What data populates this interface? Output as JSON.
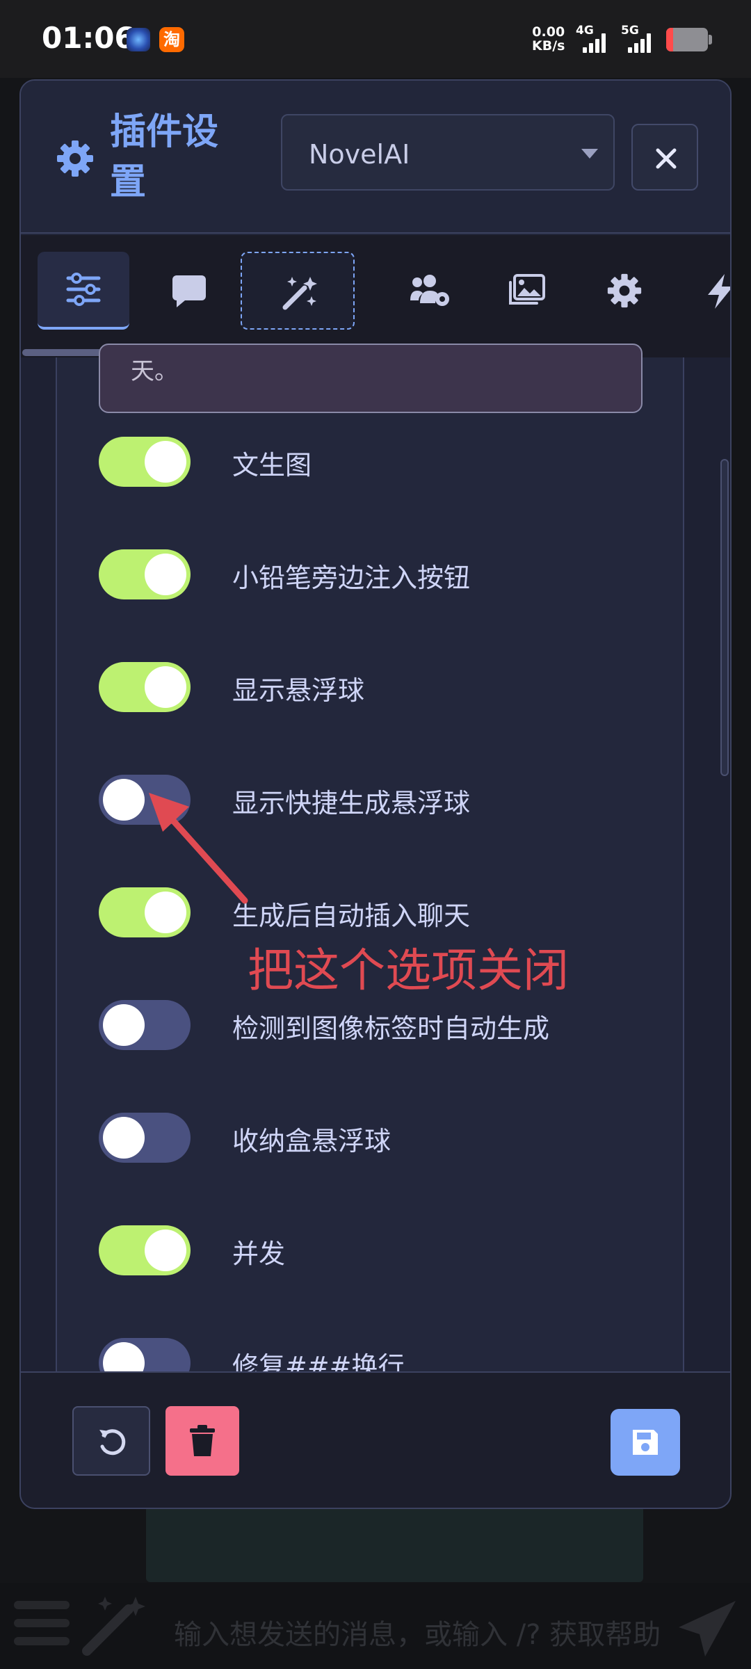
{
  "status_bar": {
    "time": "01:06",
    "app_badge": "淘",
    "speed_value": "0.00",
    "speed_unit": "KB/s",
    "net1": "4G",
    "net2": "5G"
  },
  "dialog": {
    "title": "插件设置",
    "provider_select": {
      "value": "NovelAI"
    },
    "tabs": [
      {
        "icon": "sliders-icon",
        "active": true
      },
      {
        "icon": "chat-bubble-icon",
        "active": false
      },
      {
        "icon": "magic-wand-icon",
        "focused": true
      },
      {
        "icon": "users-cog-icon",
        "active": false
      },
      {
        "icon": "images-icon",
        "active": false
      },
      {
        "icon": "gear-icon",
        "active": false
      },
      {
        "icon": "bolt-icon",
        "active": false
      }
    ],
    "textarea_fragment": "天。",
    "toggles": [
      {
        "label": "文生图",
        "on": true
      },
      {
        "label": "小铅笔旁边注入按钮",
        "on": true
      },
      {
        "label": "显示悬浮球",
        "on": true
      },
      {
        "label": "显示快捷生成悬浮球",
        "on": false
      },
      {
        "label": "生成后自动插入聊天",
        "on": true
      },
      {
        "label": "检测到图像标签时自动生成",
        "on": false
      },
      {
        "label": "收纳盒悬浮球",
        "on": false
      },
      {
        "label": "并发",
        "on": true
      },
      {
        "label": "修复###换行",
        "on": false
      }
    ]
  },
  "annotation": {
    "text": "把这个选项关闭",
    "color": "#e04a52"
  },
  "background_app": {
    "input_placeholder": "输入想发送的消息，或输入 /? 获取帮助"
  },
  "colors": {
    "accent": "#7ea6f7",
    "toggle_on": "#bdf171",
    "toggle_off": "#4a5180",
    "danger": "#f5708a"
  }
}
